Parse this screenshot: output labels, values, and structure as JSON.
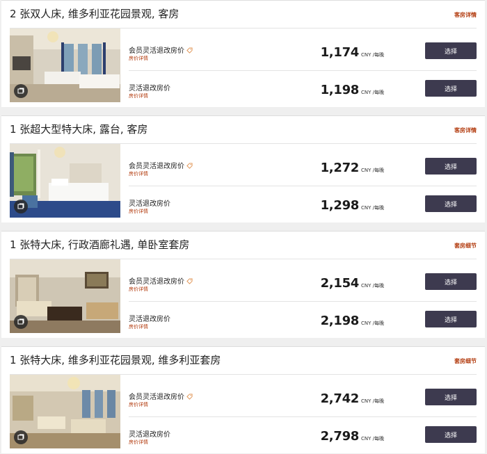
{
  "rooms": [
    {
      "title": "2 张双人床, 维多利亚花园景观, 客房",
      "link": "客房详情",
      "rates": [
        {
          "name": "会员灵活退改房价",
          "details": "房价详情",
          "member_tag": true,
          "price": "1,174",
          "unit": "CNY /每晚",
          "button": "选择"
        },
        {
          "name": "灵活退改房价",
          "details": "房价详情",
          "member_tag": false,
          "price": "1,198",
          "unit": "CNY /每晚",
          "button": "选择"
        }
      ]
    },
    {
      "title": "1 张超大型特大床, 露台, 客房",
      "link": "客房详情",
      "rates": [
        {
          "name": "会员灵活退改房价",
          "details": "房价详情",
          "member_tag": true,
          "price": "1,272",
          "unit": "CNY /每晚",
          "button": "选择"
        },
        {
          "name": "灵活退改房价",
          "details": "房价详情",
          "member_tag": false,
          "price": "1,298",
          "unit": "CNY /每晚",
          "button": "选择"
        }
      ]
    },
    {
      "title": "1 张特大床, 行政酒廊礼遇, 单卧室套房",
      "link": "套房细节",
      "rates": [
        {
          "name": "会员灵活退改房价",
          "details": "房价详情",
          "member_tag": true,
          "price": "2,154",
          "unit": "CNY /每晚",
          "button": "选择"
        },
        {
          "name": "灵活退改房价",
          "details": "房价详情",
          "member_tag": false,
          "price": "2,198",
          "unit": "CNY /每晚",
          "button": "选择"
        }
      ]
    },
    {
      "title": "1 张特大床, 维多利亚花园景观, 维多利亚套房",
      "link": "套房细节",
      "rates": [
        {
          "name": "会员灵活退改房价",
          "details": "房价详情",
          "member_tag": true,
          "price": "2,742",
          "unit": "CNY /每晚",
          "button": "选择"
        },
        {
          "name": "灵活退改房价",
          "details": "房价详情",
          "member_tag": false,
          "price": "2,798",
          "unit": "CNY /每晚",
          "button": "选择"
        }
      ]
    }
  ],
  "icons": {
    "gallery_badge": "gallery-icon",
    "member_tag": "tag-icon"
  },
  "colors": {
    "accent": "#b23a0d",
    "button": "#3d3a4f"
  }
}
